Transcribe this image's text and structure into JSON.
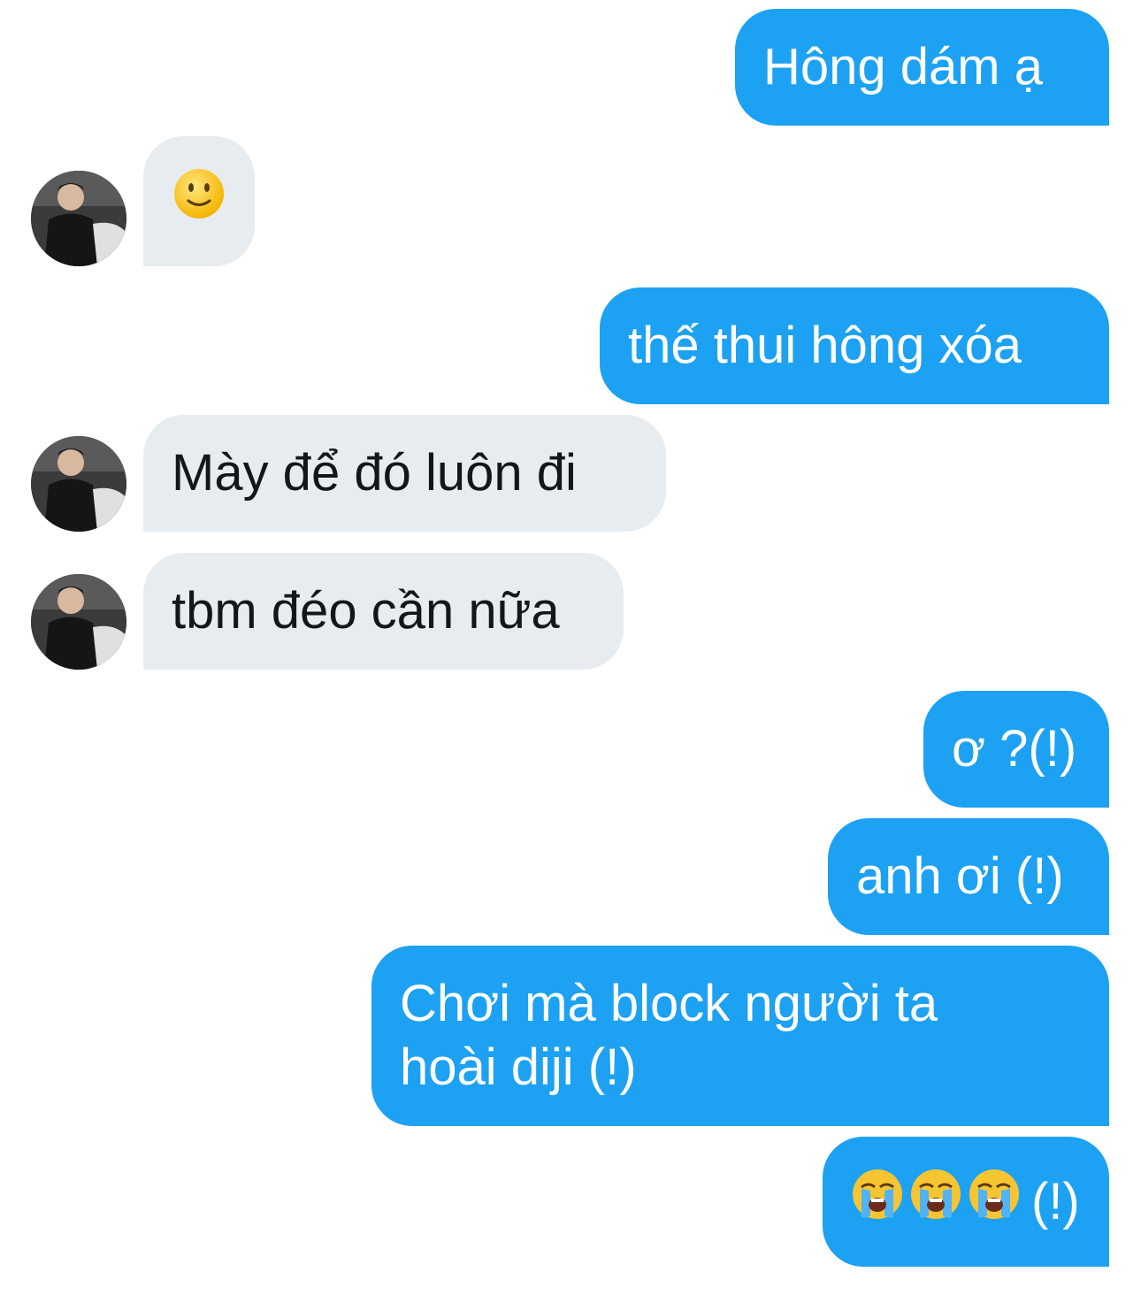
{
  "conversation": {
    "messages": [
      {
        "sender": "me",
        "text": "Hông dám ạ"
      },
      {
        "sender": "contact",
        "emoji": "slightly-smiling-face"
      },
      {
        "sender": "me",
        "text": "thế thui hông xóa"
      },
      {
        "sender": "contact",
        "text": "Mày để đó luôn đi"
      },
      {
        "sender": "contact",
        "text": "tbm đéo cần nữa"
      },
      {
        "sender": "me",
        "text": "ơ ?(!)"
      },
      {
        "sender": "me",
        "text": "anh ơi (!)"
      },
      {
        "sender": "me",
        "text": "Chơi mà block người ta hoài diji (!)"
      },
      {
        "sender": "me",
        "emoji": "loudly-crying-face",
        "emoji_count": 3,
        "text_suffix": "(!)"
      }
    ]
  },
  "colors": {
    "outgoing_bubble": "#1da1f2",
    "incoming_bubble": "#e6ecf0",
    "outgoing_text": "#ffffff",
    "incoming_text": "#14171a",
    "background": "#ffffff"
  }
}
